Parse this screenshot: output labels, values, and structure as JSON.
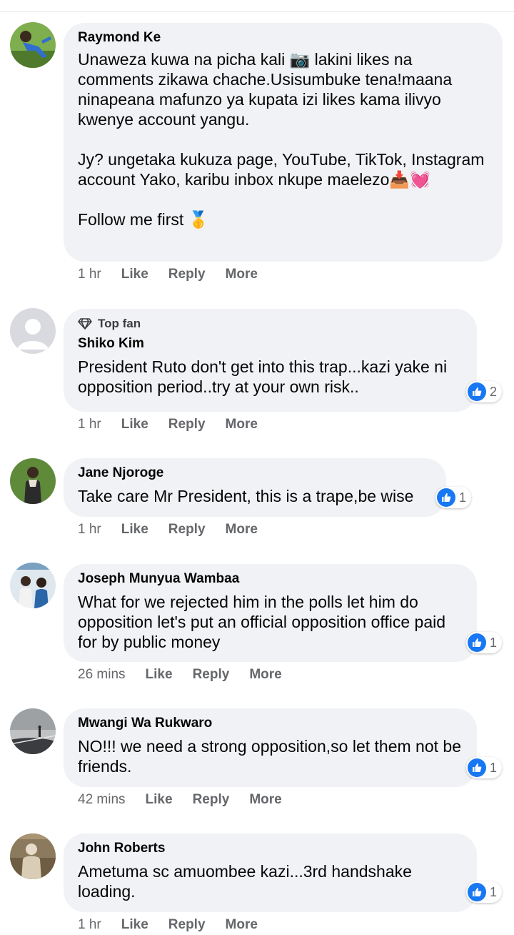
{
  "actions": {
    "like": "Like",
    "reply": "Reply",
    "more": "More"
  },
  "top_fan_label": "Top fan",
  "colors": {
    "bubble": "#f0f2f5",
    "like_blue": "#1877f2",
    "meta_grey": "#65676b"
  },
  "comments": [
    {
      "author": "Raymond Ke",
      "text_1": "Unaweza kuwa na picha kali 📷 lakini likes na comments zikawa chache.Usisumbuke tena!maana ninapeana mafunzo ya kupata izi likes kama ilivyo kwenye account yangu.",
      "text_2": "Jy? ungetaka kukuza page, YouTube, TikTok, Instagram account Yako, karibu inbox nkupe maelezo📥💓",
      "text_3": "Follow me first 🥇",
      "time": "1 hr"
    },
    {
      "author": "Shiko Kim",
      "top_fan": true,
      "text": "President Ruto don't get into this trap...kazi yake ni opposition period..try at your own risk..",
      "time": "1 hr",
      "reactions": "2"
    },
    {
      "author": "Jane Njoroge",
      "text": "Take care Mr President, this is a trape,be wise",
      "time": "1 hr",
      "reactions": "1"
    },
    {
      "author": "Joseph Munyua Wambaa",
      "text": "What for we rejected him in the polls let him do opposition let's put an official opposition office paid for by public money",
      "time": "26 mins",
      "reactions": "1"
    },
    {
      "author": "Mwangi Wa Rukwaro",
      "text": "NO!!! we need a strong opposition,so let them not be friends.",
      "time": "42 mins",
      "reactions": "1"
    },
    {
      "author": "John Roberts",
      "text": "Ametuma sc amuombee kazi...3rd handshake loading.",
      "time": "1 hr",
      "reactions": "1"
    }
  ]
}
